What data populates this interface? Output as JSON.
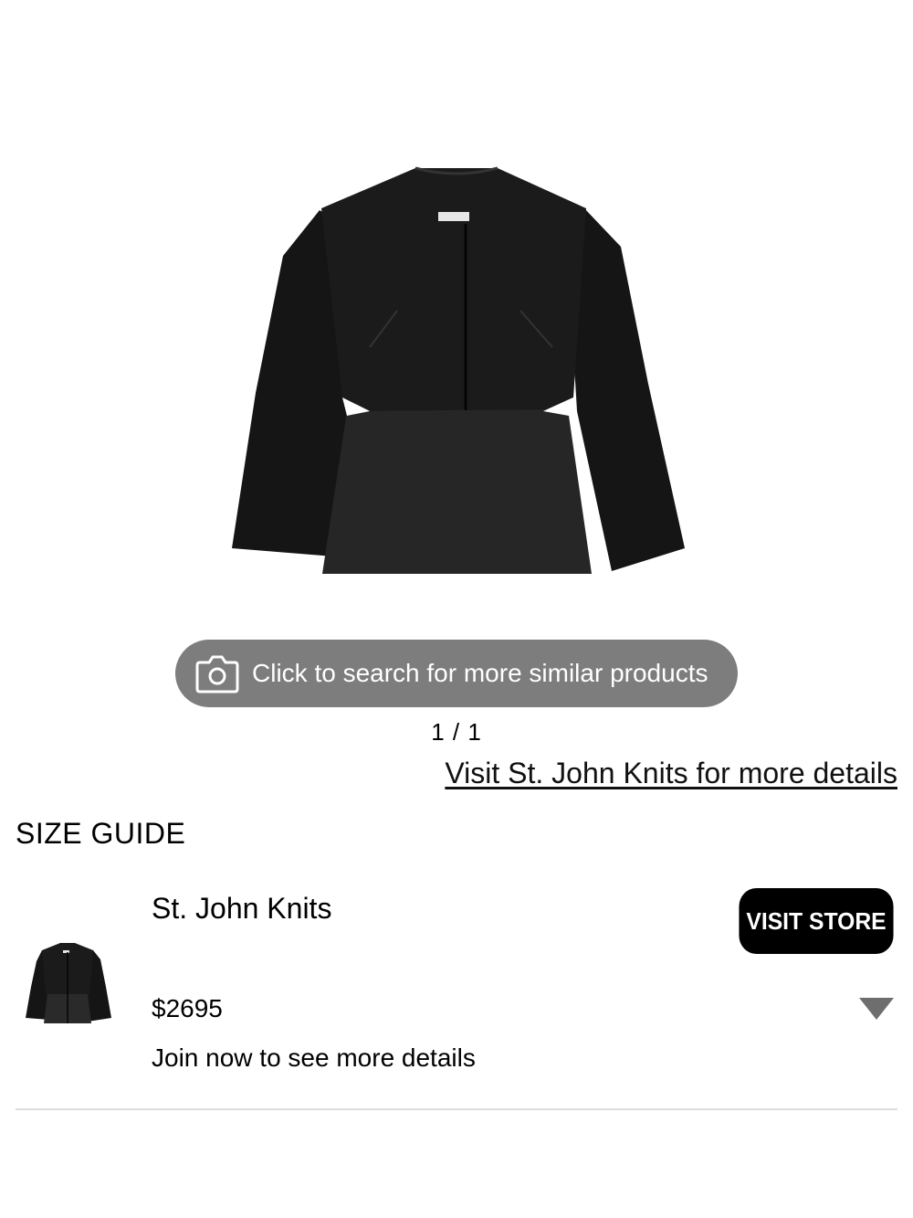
{
  "product_image": {
    "icon": "jacket-image",
    "color": "#141414"
  },
  "search_pill": {
    "icon": "camera-icon",
    "label": "Click to search for more similar products",
    "background": "#7d7d7d"
  },
  "pager": {
    "label": "1 / 1"
  },
  "visit_link": {
    "label": "Visit St. John Knits for more details"
  },
  "size_guide": {
    "label": "SIZE GUIDE"
  },
  "listing": {
    "thumbnail_icon": "jacket-thumbnail",
    "brand": "St. John Knits",
    "price": "$2695",
    "cta": "Join now to see more details",
    "visit_store_label": "VISIT STORE",
    "expand_icon": "caret-down-icon"
  }
}
